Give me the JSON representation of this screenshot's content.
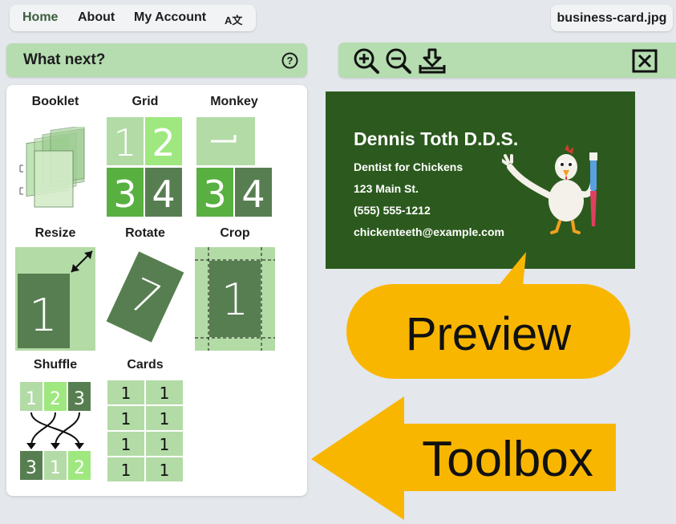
{
  "nav": {
    "home": "Home",
    "about": "About",
    "account": "My Account",
    "language_icon": "A文"
  },
  "file": {
    "name": "business-card.jpg"
  },
  "whatnext": {
    "title": "What next?",
    "help_icon": "?"
  },
  "preview_toolbar": {
    "icons": [
      "zoom-in-icon",
      "zoom-out-icon",
      "download-icon",
      "close-icon"
    ]
  },
  "tools": {
    "booklet": "Booklet",
    "grid": "Grid",
    "monkey": "Monkey",
    "resize": "Resize",
    "rotate": "Rotate",
    "crop": "Crop",
    "shuffle": "Shuffle",
    "cards": "Cards"
  },
  "thumb_text": {
    "grid": [
      "1",
      "2",
      "3",
      "4"
    ],
    "monkey": [
      "3",
      "4"
    ],
    "resize": "1",
    "rotate": "7",
    "crop": "1",
    "shuffle_top": [
      "1",
      "2",
      "3"
    ],
    "shuffle_bottom": [
      "3",
      "1",
      "2"
    ],
    "cards": [
      "1",
      "1",
      "1",
      "1",
      "1",
      "1",
      "1",
      "1"
    ]
  },
  "card": {
    "name": "Dennis Toth D.D.S.",
    "tagline": "Dentist for Chickens",
    "address": "123 Main St.",
    "phone": "(555) 555-1212",
    "email": "chickenteeth@example.com"
  },
  "callouts": {
    "preview": "Preview",
    "toolbox": "Toolbox"
  },
  "colors": {
    "accent_green": "#b5ddb0",
    "card_green": "#2c5a1e",
    "callout_yellow": "#f9b600",
    "dark_tile": "#577e50",
    "mid_tile": "#58b040",
    "light_tile": "#b3dba6",
    "bright_tile": "#9ee87f"
  }
}
